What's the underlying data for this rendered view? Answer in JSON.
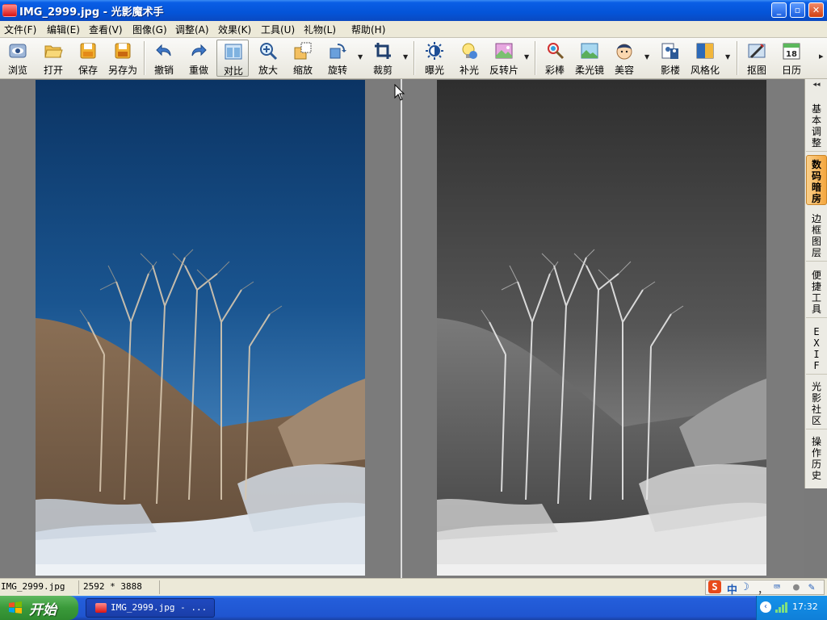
{
  "window": {
    "title": "IMG_2999.jpg - 光影魔术手",
    "minimize_label": "_",
    "maximize_label": "▫",
    "close_label": "✕"
  },
  "menu": [
    {
      "label": "文件(F)"
    },
    {
      "label": "编辑(E)"
    },
    {
      "label": "查看(V)"
    },
    {
      "label": "图像(G)"
    },
    {
      "label": "调整(A)"
    },
    {
      "label": "效果(K)"
    },
    {
      "label": "工具(U)"
    },
    {
      "label": "礼物(L)"
    },
    {
      "label": "帮助(H)"
    }
  ],
  "toolbar": {
    "browse": "浏览",
    "open": "打开",
    "save": "保存",
    "save_as": "另存为",
    "undo": "撤销",
    "redo": "重做",
    "compare": "对比",
    "zoom_in": "放大",
    "resize": "缩放",
    "rotate": "旋转",
    "crop": "裁剪",
    "exposure": "曝光",
    "fill_light": "补光",
    "reversal": "反转片",
    "color_wand": "彩棒",
    "soft_focus": "柔光镜",
    "beauty": "美容",
    "shadow": "影楼",
    "stylize": "风格化",
    "cutout": "抠图",
    "calendar": "日历",
    "calendar_day": "18",
    "more": "▸"
  },
  "side_panel": {
    "collapse": "◂◂",
    "tabs": [
      {
        "label": "基本调整"
      },
      {
        "label": "数码暗房"
      },
      {
        "label": "边框图层"
      },
      {
        "label": "便捷工具"
      },
      {
        "label": "EXIF"
      },
      {
        "label": "光影社区"
      },
      {
        "label": "操作历史"
      }
    ]
  },
  "status": {
    "filename": "IMG_2999.jpg",
    "dimensions": "2592 * 3888"
  },
  "ime": {
    "logo": "S",
    "mode": "中",
    "moon": "☽",
    "comma": "，",
    "keyboard": "⌨",
    "user": "●",
    "tools": "✎"
  },
  "taskbar": {
    "start_label": "开始",
    "task_label": "IMG_2999.jpg - ...",
    "tray_arrow": "‹",
    "clock": "17:32"
  }
}
